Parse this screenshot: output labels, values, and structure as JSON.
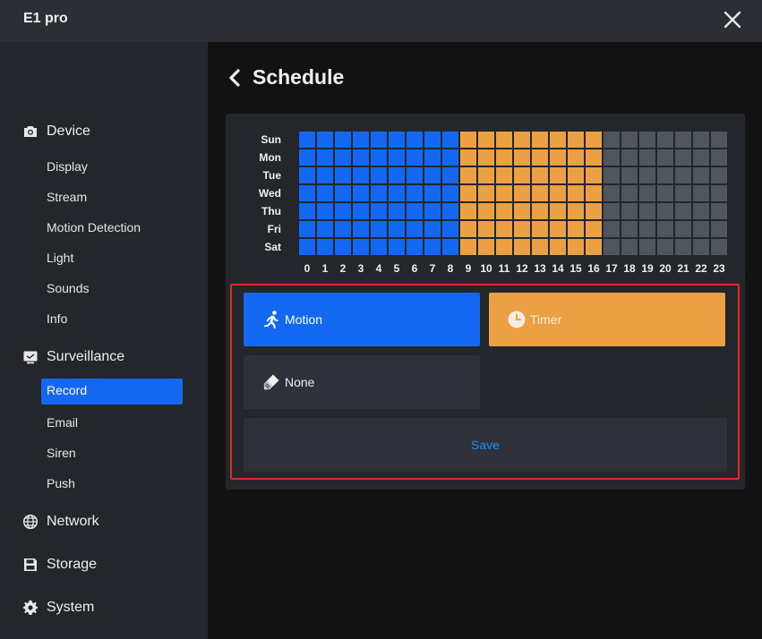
{
  "window": {
    "title": "E1 pro"
  },
  "sidebar": {
    "sections": [
      {
        "label": "Device",
        "icon": "camera-icon"
      },
      {
        "label": "Surveillance",
        "icon": "monitor-icon"
      },
      {
        "label": "Network",
        "icon": "globe-icon"
      },
      {
        "label": "Storage",
        "icon": "save-icon"
      },
      {
        "label": "System",
        "icon": "gear-icon"
      }
    ],
    "device_items": [
      "Display",
      "Stream",
      "Motion Detection",
      "Light",
      "Sounds",
      "Info"
    ],
    "surveillance_items": [
      "Record",
      "Email",
      "Siren",
      "Push"
    ],
    "active_item": "Record"
  },
  "page": {
    "title": "Schedule",
    "back_icon": "chevron-left-icon"
  },
  "schedule": {
    "days": [
      "Sun",
      "Mon",
      "Tue",
      "Wed",
      "Thu",
      "Fri",
      "Sat"
    ],
    "hours": [
      "0",
      "1",
      "2",
      "3",
      "4",
      "5",
      "6",
      "7",
      "8",
      "9",
      "10",
      "11",
      "12",
      "13",
      "14",
      "15",
      "16",
      "17",
      "18",
      "19",
      "20",
      "21",
      "22",
      "23"
    ],
    "hour_modes": [
      "motion",
      "motion",
      "motion",
      "motion",
      "motion",
      "motion",
      "motion",
      "motion",
      "motion",
      "timer",
      "timer",
      "timer",
      "timer",
      "timer",
      "timer",
      "timer",
      "timer",
      "none",
      "none",
      "none",
      "none",
      "none",
      "none",
      "none"
    ],
    "colors": {
      "motion": "#1467f0",
      "timer": "#eba044",
      "none": "#50565e"
    }
  },
  "modes": {
    "motion": {
      "label": "Motion",
      "icon": "running-person-icon",
      "color": "#1467f0"
    },
    "timer": {
      "label": "Timer",
      "icon": "clock-icon",
      "color": "#eba044"
    },
    "none": {
      "label": "None",
      "icon": "eraser-icon",
      "color": "#2e3139"
    }
  },
  "save": {
    "label": "Save"
  }
}
